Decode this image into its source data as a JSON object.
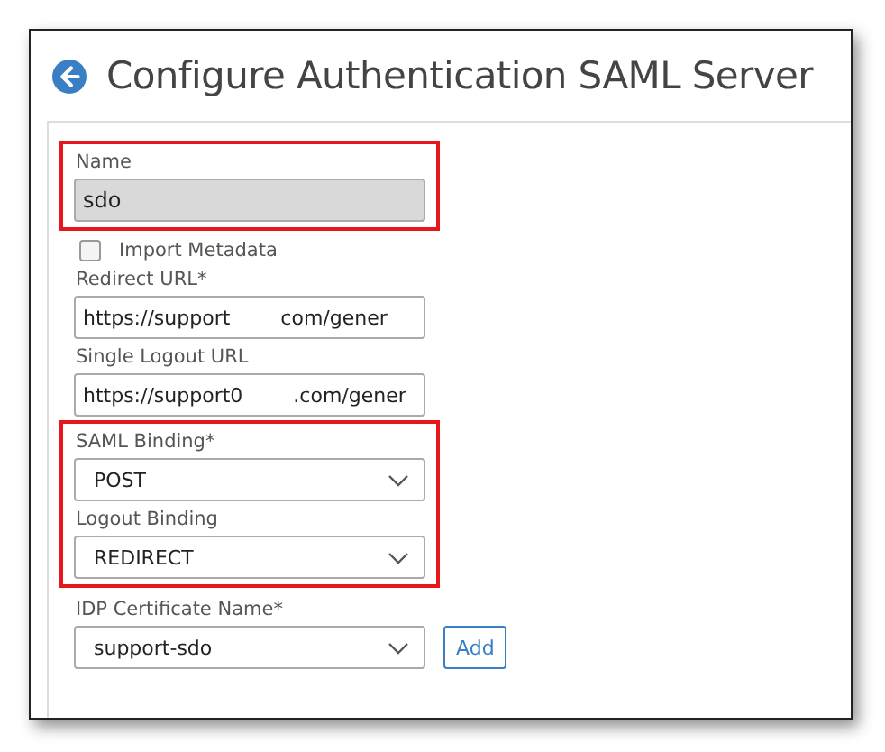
{
  "title": "Configure Authentication SAML Server",
  "groups": [
    {
      "highlighted": true,
      "fields": [
        {
          "kind": "text",
          "label": "Name",
          "value": "sdo",
          "disabled": true
        }
      ]
    },
    {
      "highlighted": false,
      "fields": [
        {
          "kind": "checkbox",
          "label": "Import Metadata",
          "checked": false
        },
        {
          "kind": "redacted",
          "label": "Redirect URL*",
          "value_start": "https://support",
          "value_end": "com/gener"
        },
        {
          "kind": "redacted",
          "label": "Single Logout URL",
          "value_start": "https://support0",
          "value_end": ".com/gener"
        }
      ]
    },
    {
      "highlighted": true,
      "fields": [
        {
          "kind": "select",
          "label": "SAML Binding*",
          "value": "POST"
        },
        {
          "kind": "select",
          "label": "Logout Binding",
          "value": "REDIRECT"
        }
      ]
    },
    {
      "highlighted": false,
      "fields": [
        {
          "kind": "select",
          "label": "IDP Certificate Name*",
          "value": "support-sdo",
          "action": "Add"
        }
      ]
    }
  ]
}
